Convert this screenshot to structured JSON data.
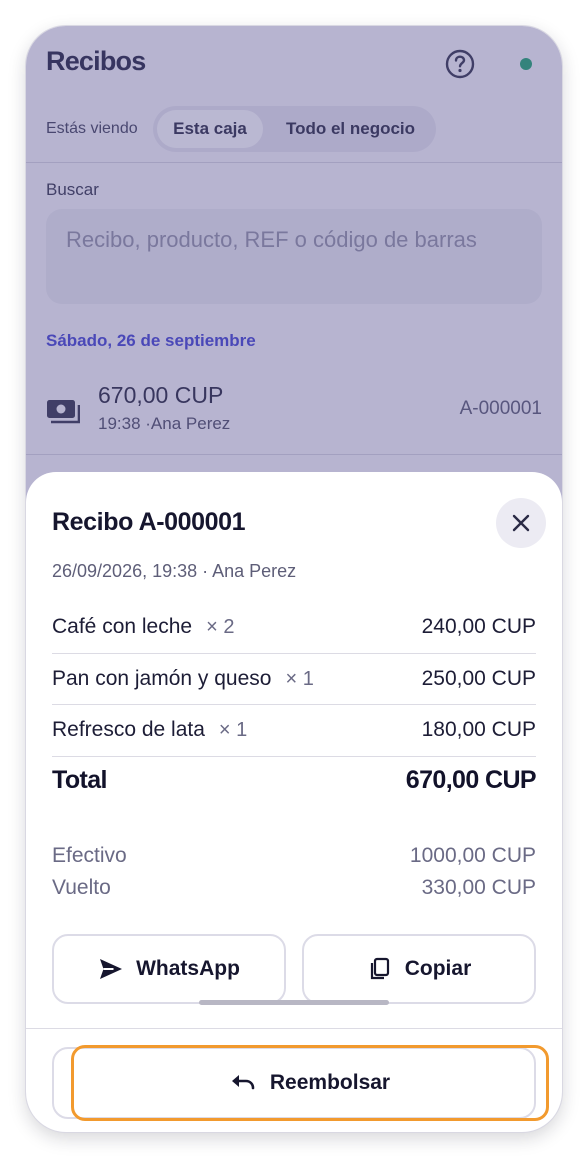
{
  "header": {
    "title": "Recibos"
  },
  "view_switch": {
    "label": "Estás viendo",
    "options": [
      "Esta caja",
      "Todo el negocio"
    ]
  },
  "search": {
    "label": "Buscar",
    "placeholder": "Recibo, producto, REF o código de barras"
  },
  "receipts_list": {
    "day_header": "Sábado, 26 de septiembre",
    "rows": [
      {
        "amount": "670,00 CUP",
        "sub": "19:38 ·Ana Perez",
        "id": "A-000001"
      }
    ]
  },
  "sheet": {
    "title": "Recibo A-000001",
    "meta": "26/09/2026, 19:38 · Ana Perez",
    "items": [
      {
        "name": "Café con leche",
        "qty": "× 2",
        "price": "240,00 CUP"
      },
      {
        "name": "Pan con jamón y queso",
        "qty": "× 1",
        "price": "250,00 CUP"
      },
      {
        "name": "Refresco de lata",
        "qty": "× 1",
        "price": "180,00 CUP"
      }
    ],
    "total_label": "Total",
    "total_value": "670,00 CUP",
    "cash_label": "Efectivo",
    "cash_value": "1000,00 CUP",
    "change_label": "Vuelto",
    "change_value": "330,00 CUP",
    "whatsapp_label": "WhatsApp",
    "copy_label": "Copiar",
    "refund_label": "Reembolsar"
  },
  "colors": {
    "accent": "#3b3bd0",
    "status": "#16a06a",
    "highlight": "#f29a2e"
  }
}
